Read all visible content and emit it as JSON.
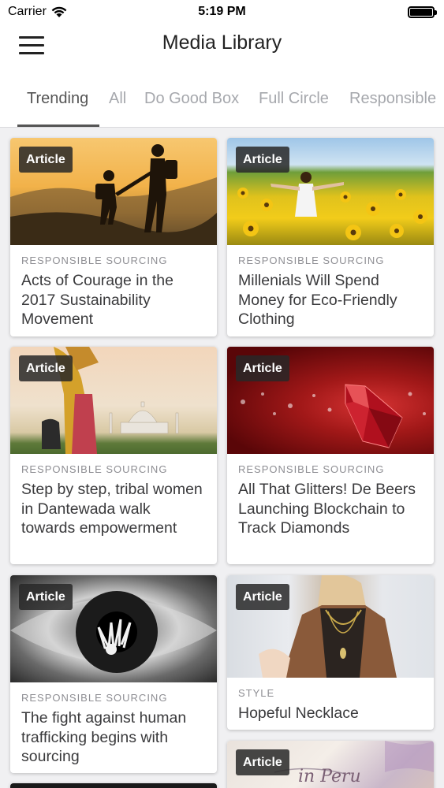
{
  "status_bar": {
    "carrier": "Carrier",
    "time": "5:19 PM"
  },
  "nav": {
    "title": "Media Library"
  },
  "tabs": [
    {
      "label": "Trending",
      "active": true
    },
    {
      "label": "All",
      "active": false
    },
    {
      "label": "Do Good Box",
      "active": false
    },
    {
      "label": "Full Circle",
      "active": false
    },
    {
      "label": "Responsible",
      "active": false
    }
  ],
  "cards": [
    {
      "badge": "Article",
      "category": "RESPONSIBLE SOURCING",
      "title": "Acts of Courage in the 2017 Sustainability Movement",
      "image": "hikers-at-sunset"
    },
    {
      "badge": "Article",
      "category": "RESPONSIBLE SOURCING",
      "title": "Millenials Will Spend Money for Eco-Friendly Clothing",
      "image": "woman-in-sunflower-field"
    },
    {
      "badge": "Article",
      "category": "RESPONSIBLE SOURCING",
      "title": "Step by step, tribal women in Dantewada walk towards empowerment",
      "image": "woman-near-taj-mahal"
    },
    {
      "badge": "Article",
      "category": "RESPONSIBLE SOURCING",
      "title": "All That Glitters! De Beers Launching Blockchain to Track Diamonds",
      "image": "red-diamond"
    },
    {
      "badge": "Article",
      "category": "RESPONSIBLE SOURCING",
      "title": "The fight against human trafficking begins with sourcing",
      "image": "eye-with-hand"
    },
    {
      "badge": "Article",
      "category": "STYLE",
      "title": "Hopeful Necklace",
      "image": "woman-wearing-necklace"
    },
    {
      "badge": "Article",
      "image": "made-in-peru",
      "image_text": "in Peru"
    }
  ],
  "colors": {
    "background": "#f0f0f2",
    "tab_active": "#555555",
    "tab_inactive": "#a6a8ad",
    "badge_bg": "#2b2b2b"
  }
}
